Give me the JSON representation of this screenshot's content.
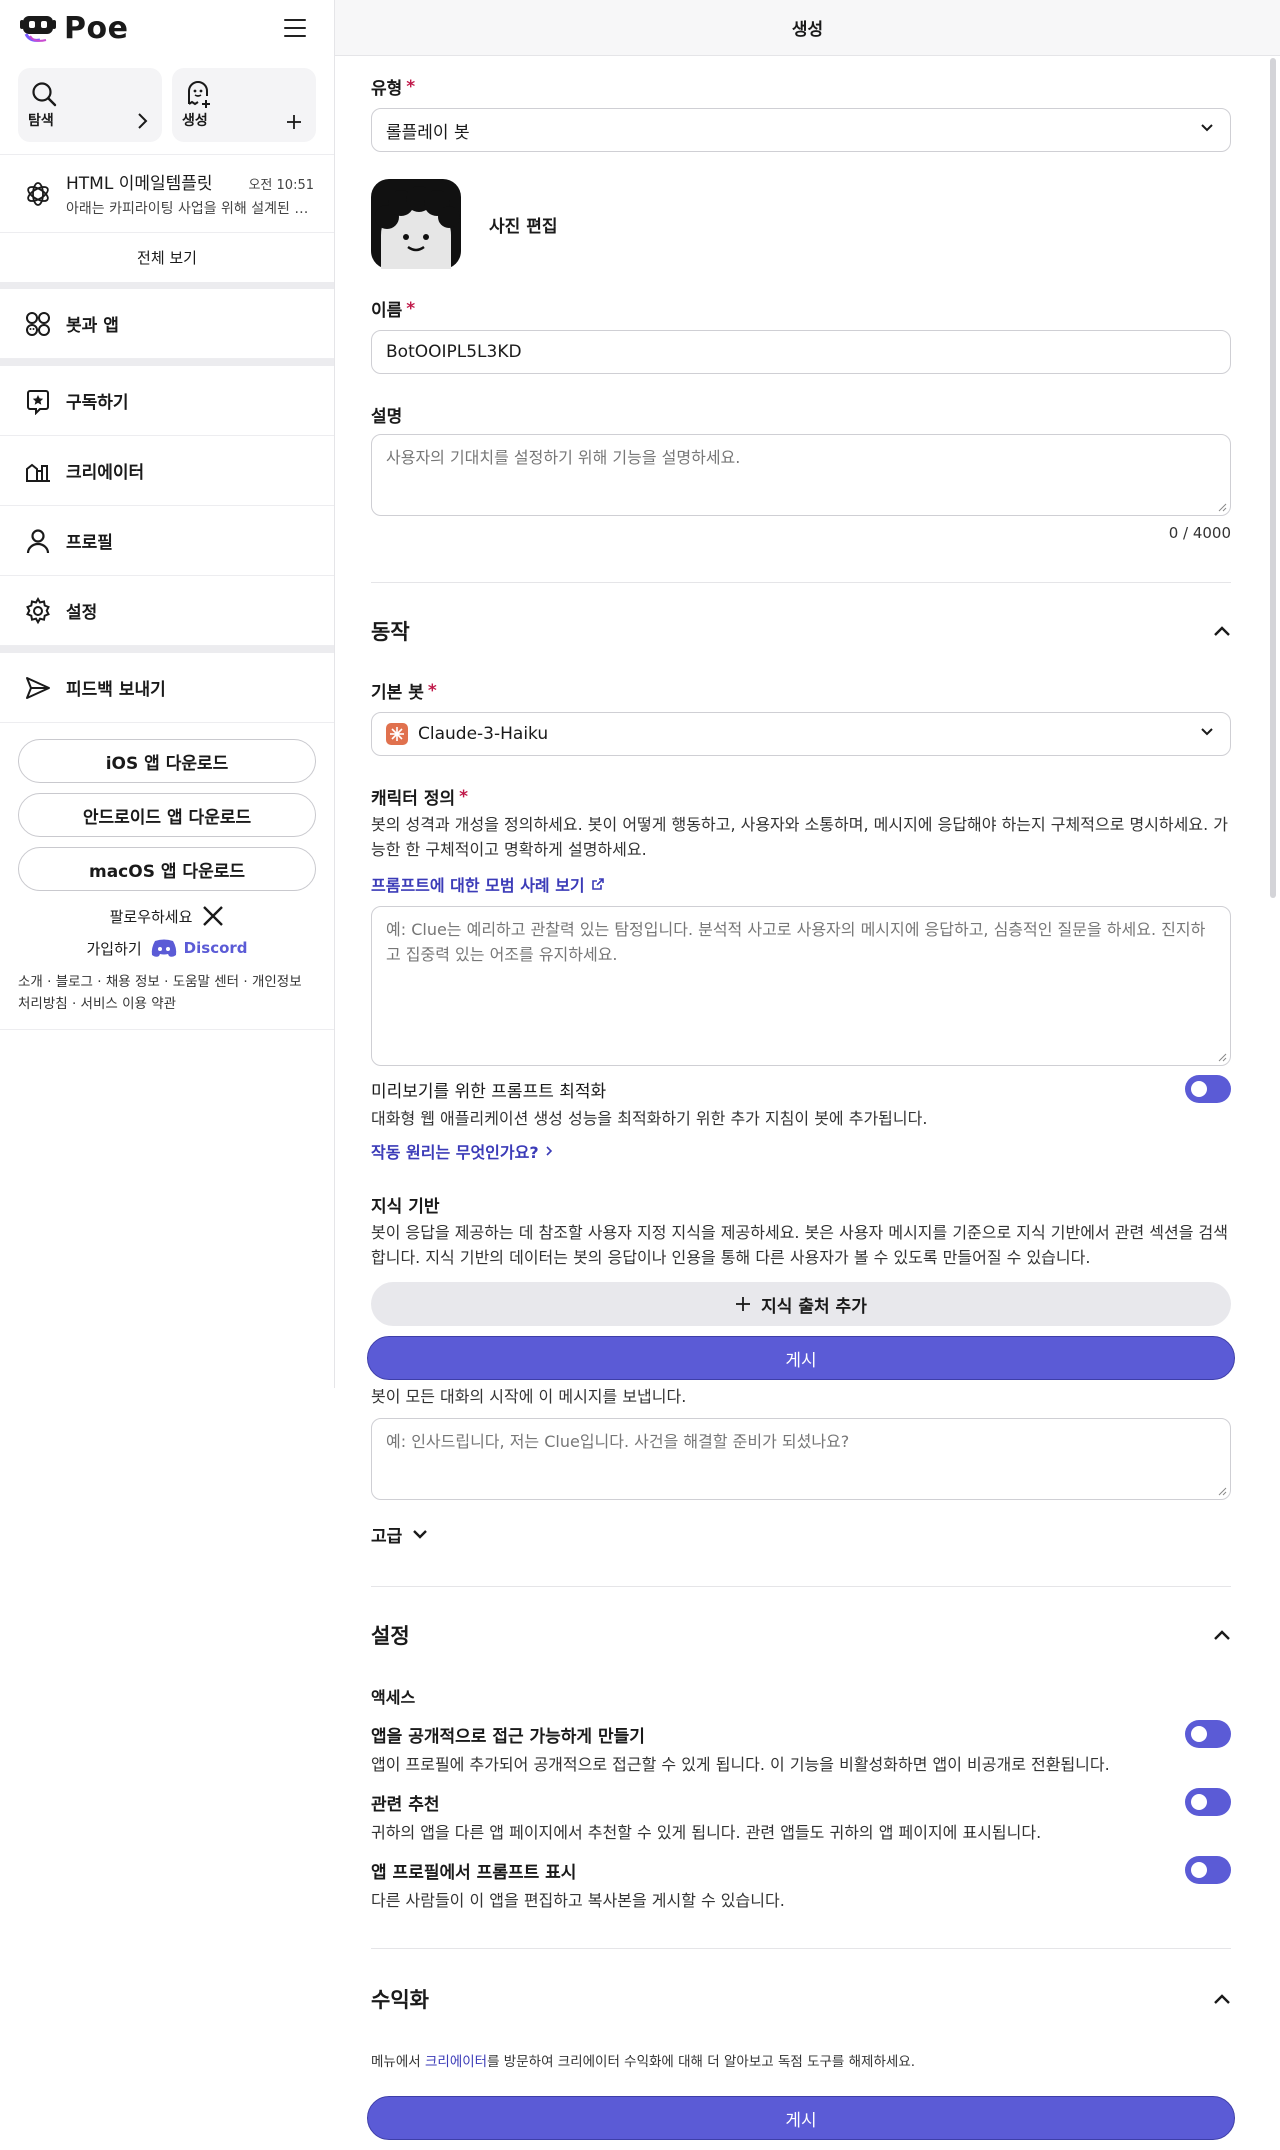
{
  "app": {
    "name": "Poe",
    "page_title": "생성"
  },
  "sidebar": {
    "quick": [
      {
        "label": "탐색",
        "icon": "search-icon",
        "action_icon": "chevron-right-icon"
      },
      {
        "label": "생성",
        "icon": "ghost-plus-icon",
        "action_icon": "plus-icon"
      }
    ],
    "recent": {
      "title": "HTML 이메일템플릿",
      "time": "오전 10:51",
      "snippet": "아래는 카피라이팅 사업을 위해 설계된 HTML 이메일 템플릿입니다"
    },
    "view_all": "전체 보기",
    "nav": {
      "bots": "봇과 앱",
      "subscribe": "구독하기",
      "creator": "크리에이터",
      "profile": "프로필",
      "settings": "설정",
      "feedback": "피드백 보내기"
    },
    "downloads": {
      "ios": "iOS 앱 다운로드",
      "android": "안드로이드 앱 다운로드",
      "macos": "macOS 앱 다운로드"
    },
    "follow": "팔로우하세요",
    "join": "가입하기",
    "discord": "Discord",
    "footer": "소개 · 블로그 · 채용 정보 · 도움말 센터 · 개인정보 처리방침 · 서비스 이용 약관"
  },
  "form": {
    "type": {
      "label": "유형",
      "value": "롤플레이 봇"
    },
    "photo_edit": "사진 편집",
    "name": {
      "label": "이름",
      "value": "BotOOIPL5L3KD"
    },
    "description": {
      "label": "설명",
      "placeholder": "사용자의 기대치를 설정하기 위해 기능을 설명하세요.",
      "counter": "0 / 4000"
    },
    "behavior": {
      "title": "동작",
      "base_bot": {
        "label": "기본 봇",
        "value": "Claude-3-Haiku"
      },
      "character": {
        "label": "캐릭터 정의",
        "helper": "봇의 성격과 개성을 정의하세요. 봇이 어떻게 행동하고, 사용자와 소통하며, 메시지에 응답해야 하는지 구체적으로 명시하세요. 가능한 한 구체적이고 명확하게 설명하세요.",
        "link": "프롬프트에 대한 모범 사례 보기",
        "placeholder": "예: Clue는 예리하고 관찰력 있는 탐정입니다. 분석적 사고로 사용자의 메시지에 응답하고, 심층적인 질문을 하세요. 진지하고 집중력 있는 어조를 유지하세요."
      },
      "optimize": {
        "label": "미리보기를 위한 프롬프트 최적화",
        "helper": "대화형 웹 애플리케이션 생성 성능을 최적화하기 위한 추가 지침이 봇에 추가됩니다.",
        "link": "작동 원리는 무엇인가요?"
      },
      "knowledge": {
        "label": "지식 기반",
        "helper": "봇이 응답을 제공하는 데 참조할 사용자 지정 지식을 제공하세요. 봇은 사용자 메시지를 기준으로 지식 기반에서 관련 섹션을 검색합니다. 지식 기반의 데이터는 봇의 응답이나 인용을 통해 다른 사용자가 볼 수 있도록 만들어질 수 있습니다.",
        "add_button": "지식 출처 추가"
      },
      "greeting": {
        "helper": "봇이 모든 대화의 시작에 이 메시지를 보냅니다.",
        "placeholder": "예: 인사드립니다, 저는 Clue입니다. 사건을 해결할 준비가 되셨나요?"
      },
      "advanced": "고급"
    },
    "settings": {
      "title": "설정",
      "access": "액세스",
      "public": {
        "label": "앱을 공개적으로 접근 가능하게 만들기",
        "helper": "앱이 프로필에 추가되어 공개적으로 접근할 수 있게 됩니다. 이 기능을 비활성화하면 앱이 비공개로 전환됩니다."
      },
      "related": {
        "label": "관련 추천",
        "helper": "귀하의 앱을 다른 앱 페이지에서 추천할 수 있게 됩니다. 관련 앱들도 귀하의 앱 페이지에 표시됩니다."
      },
      "show_prompt": {
        "label": "앱 프로필에서 프롬프트 표시",
        "helper": "다른 사람들이 이 앱을 편집하고 복사본을 게시할 수 있습니다."
      }
    },
    "monetization": {
      "title": "수익화",
      "pre": "메뉴에서 ",
      "link": "크리에이터",
      "post": "를 방문하여 크리에이터 수익화에 대해 더 알아보고 독점 도구를 해제하세요."
    },
    "post_button": "게시"
  },
  "colors": {
    "accent": "#5b5bd6",
    "required": "#c01a4a",
    "link": "#3b3bb8"
  }
}
